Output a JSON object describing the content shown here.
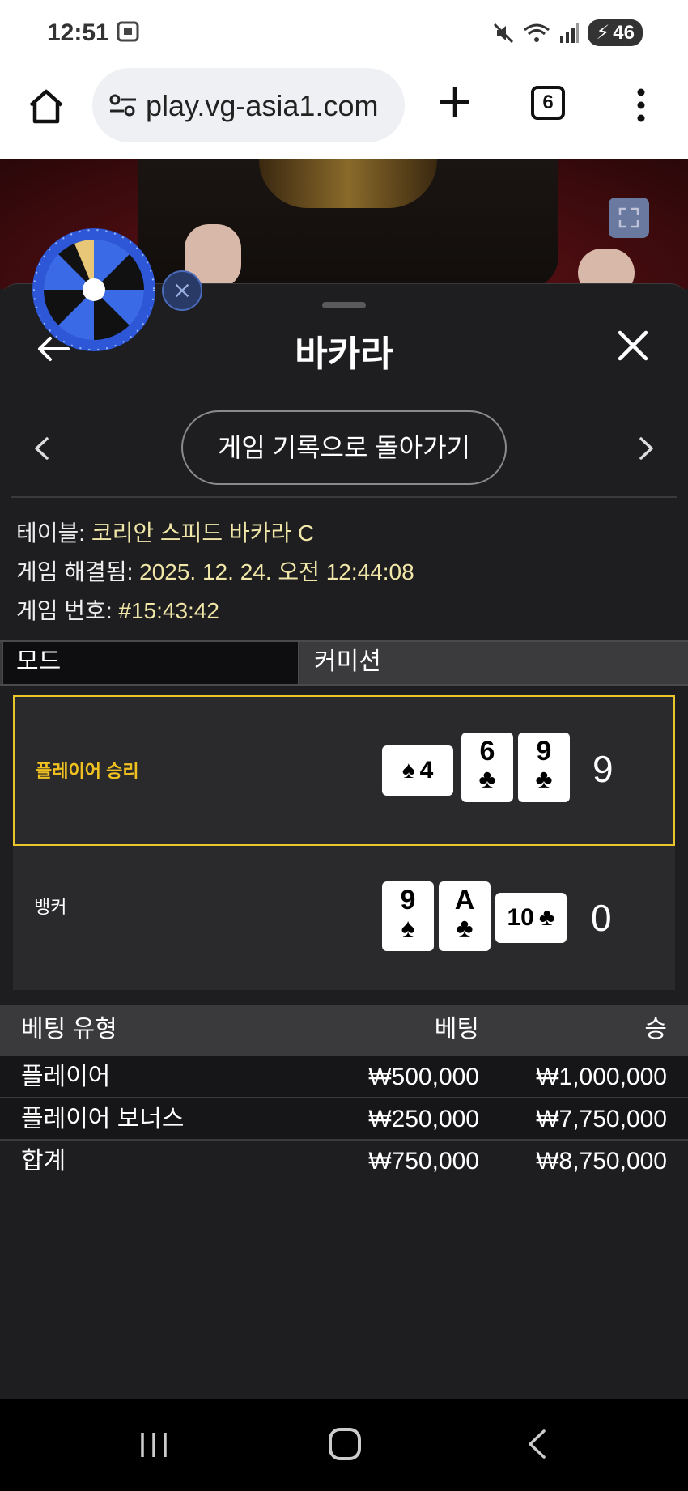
{
  "status_bar": {
    "time": "12:51",
    "battery": "46"
  },
  "browser": {
    "url": "play.vg-asia1.com",
    "tab_count": "6"
  },
  "panel": {
    "title": "바카라",
    "history_button": "게임 기록으로 돌아가기",
    "info": {
      "table_label": "테이블: ",
      "table_value": "코리안 스피드 바카라 C",
      "resolved_label": "게임 해결됨: ",
      "resolved_value": "2025. 12. 24. 오전 12:44:08",
      "game_no_label": "게임 번호: ",
      "game_no_value": "#15:43:42"
    },
    "mode": {
      "label": "모드",
      "value": "커미션"
    }
  },
  "result": {
    "player": {
      "label": "플레이어 승리",
      "label_color": "#f0c020",
      "score": "9",
      "cards": [
        {
          "rank": "4",
          "suit": "♠",
          "orientation": "sideways"
        },
        {
          "rank": "6",
          "suit": "♣",
          "orientation": "upright"
        },
        {
          "rank": "9",
          "suit": "♣",
          "orientation": "upright"
        }
      ]
    },
    "banker": {
      "label": "뱅커",
      "score": "0",
      "cards": [
        {
          "rank": "9",
          "suit": "♠",
          "orientation": "upright"
        },
        {
          "rank": "A",
          "suit": "♣",
          "orientation": "upright"
        },
        {
          "rank": "10",
          "suit": "♣",
          "orientation": "sideways"
        }
      ]
    }
  },
  "bets": {
    "headers": {
      "type": "베팅 유형",
      "bet": "베팅",
      "win": "승"
    },
    "rows": [
      {
        "type": "플레이어",
        "bet": "₩500,000",
        "win": "₩1,000,000"
      },
      {
        "type": "플레이어 보너스",
        "bet": "₩250,000",
        "win": "₩7,750,000"
      }
    ],
    "total": {
      "type": "합계",
      "bet": "₩750,000",
      "win": "₩8,750,000"
    }
  },
  "colors": {
    "highlight_border": "#e8c52a",
    "panel_bg": "#1e1e20",
    "accent_blue": "#2e5bd8"
  }
}
